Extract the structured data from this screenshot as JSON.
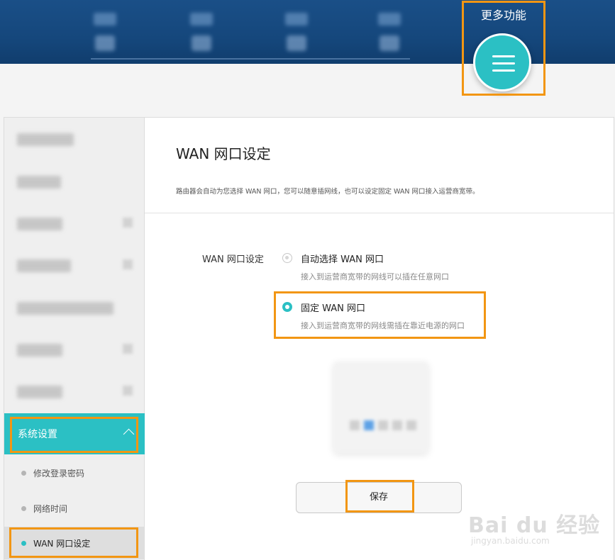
{
  "header": {
    "more_features_label": "更多功能"
  },
  "sidebar": {
    "active_group": {
      "label": "系统设置"
    },
    "sub_items": [
      {
        "label": "修改登录密码"
      },
      {
        "label": "网络时间"
      },
      {
        "label": "WAN 网口设定",
        "active": true
      }
    ]
  },
  "panel": {
    "title": "WAN 网口设定",
    "description": "路由器会自动为您选择 WAN 网口，您可以随意插网线，也可以设定固定 WAN 网口接入运营商宽带。",
    "field_label": "WAN 网口设定",
    "options": [
      {
        "label": "自动选择 WAN 网口",
        "desc": "接入到运营商宽带的网线可以插在任意网口",
        "selected": false
      },
      {
        "label": "固定 WAN 网口",
        "desc": "接入到运营商宽带的网线需插在靠近电源的网口",
        "selected": true
      }
    ],
    "save_label": "保存"
  },
  "watermark": {
    "brand": "Bai du 经验",
    "url": "jingyan.baidu.com"
  },
  "colors": {
    "accent": "#2bc0c4",
    "header": "#15477c",
    "highlight": "#f29613"
  }
}
